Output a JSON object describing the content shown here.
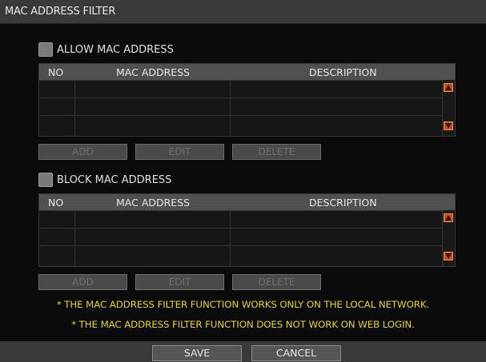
{
  "window": {
    "title": "MAC ADDRESS FILTER"
  },
  "allow": {
    "label": "ALLOW MAC ADDRESS",
    "checked": false,
    "columns": [
      "NO",
      "MAC ADDRESS",
      "DESCRIPTION"
    ],
    "rows": [
      {
        "no": "",
        "mac": "",
        "description": ""
      },
      {
        "no": "",
        "mac": "",
        "description": ""
      },
      {
        "no": "",
        "mac": "",
        "description": ""
      }
    ],
    "buttons": {
      "add": "ADD",
      "edit": "EDIT",
      "delete": "DELETE"
    }
  },
  "block": {
    "label": "BLOCK MAC ADDRESS",
    "checked": false,
    "columns": [
      "NO",
      "MAC ADDRESS",
      "DESCRIPTION"
    ],
    "rows": [
      {
        "no": "",
        "mac": "",
        "description": ""
      },
      {
        "no": "",
        "mac": "",
        "description": ""
      },
      {
        "no": "",
        "mac": "",
        "description": ""
      }
    ],
    "buttons": {
      "add": "ADD",
      "edit": "EDIT",
      "delete": "DELETE"
    }
  },
  "notes": {
    "line1": "* THE MAC ADDRESS FILTER FUNCTION WORKS ONLY ON THE LOCAL NETWORK.",
    "line2": "* THE MAC ADDRESS FILTER FUNCTION DOES NOT WORK ON WEB LOGIN."
  },
  "footer": {
    "save": "SAVE",
    "cancel": "CANCEL"
  },
  "icons": {
    "scroll_up": "triangle-up-icon",
    "scroll_down": "triangle-down-icon"
  },
  "colors": {
    "accent": "#c8501a",
    "note": "#e6d23a"
  }
}
